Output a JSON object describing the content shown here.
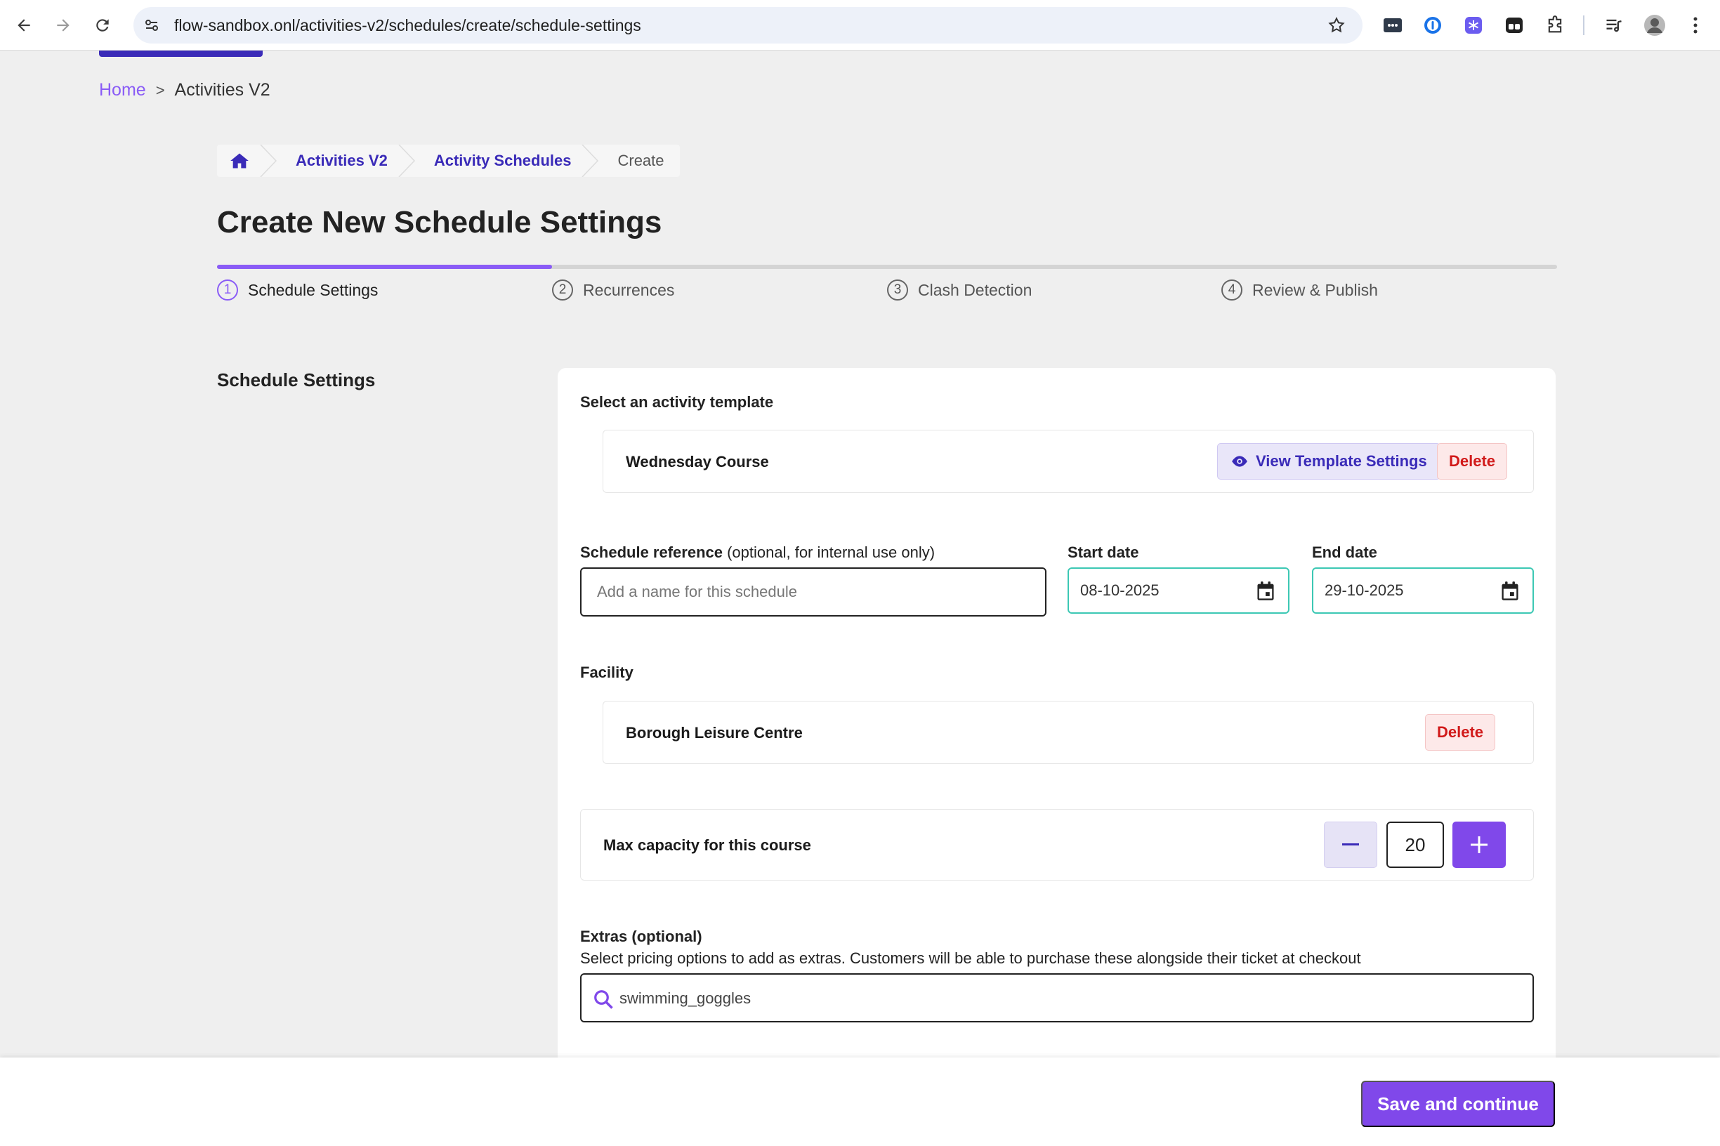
{
  "browser": {
    "url": "flow-sandbox.onl/activities-v2/schedules/create/schedule-settings"
  },
  "breadcrumb_top": {
    "home": "Home",
    "separator": ">",
    "current": "Activities V2"
  },
  "breadcrumb_nav": {
    "items": [
      "Activities V2",
      "Activity Schedules",
      "Create"
    ]
  },
  "page_title": "Create New Schedule Settings",
  "steps": [
    {
      "number": "1",
      "label": "Schedule Settings",
      "active": true
    },
    {
      "number": "2",
      "label": "Recurrences",
      "active": false
    },
    {
      "number": "3",
      "label": "Clash Detection",
      "active": false
    },
    {
      "number": "4",
      "label": "Review & Publish",
      "active": false
    }
  ],
  "progress_fraction": 0.25,
  "section_label": "Schedule Settings",
  "template": {
    "label": "Select an activity template",
    "name": "Wednesday Course",
    "view_button": "View Template Settings",
    "delete_button": "Delete"
  },
  "schedule_reference": {
    "label": "Schedule reference",
    "label_optional": " (optional, for internal use only)",
    "placeholder": "Add a name for this schedule",
    "value": ""
  },
  "start_date": {
    "label": "Start date",
    "value": "08-10-2025"
  },
  "end_date": {
    "label": "End date",
    "value": "29-10-2025"
  },
  "facility": {
    "label": "Facility",
    "name": "Borough Leisure Centre",
    "delete_button": "Delete"
  },
  "capacity": {
    "label": "Max capacity for this course",
    "value": "20"
  },
  "extras": {
    "label": "Extras (optional)",
    "description": "Select pricing options to add as extras. Customers will be able to purchase these alongside their ticket at checkout",
    "search_value": "swimming_goggles"
  },
  "footer": {
    "save_button": "Save and continue"
  },
  "colors": {
    "accent": "#8048ea",
    "link": "#3a2bb8",
    "danger": "#d11a1a",
    "date_border": "#3cc8b4"
  }
}
